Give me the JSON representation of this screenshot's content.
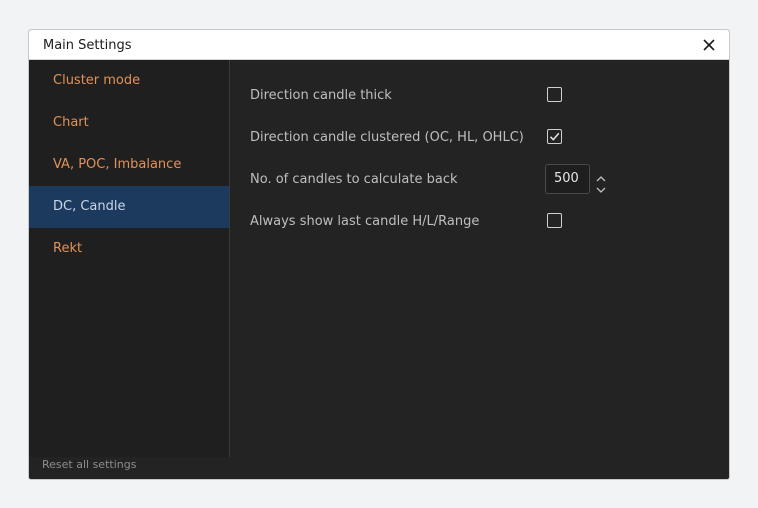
{
  "dialog": {
    "title": "Main Settings",
    "close_icon": "close-icon"
  },
  "sidebar": {
    "items": [
      {
        "label": "Cluster mode",
        "active": false
      },
      {
        "label": "Chart",
        "active": false
      },
      {
        "label": "VA, POC, Imbalance",
        "active": false
      },
      {
        "label": "DC, Candle",
        "active": true
      },
      {
        "label": "Rekt",
        "active": false
      }
    ],
    "reset_label": "Reset all settings"
  },
  "settings": {
    "direction_candle_thick": {
      "label": "Direction candle thick",
      "checked": false
    },
    "direction_candle_clustered": {
      "label": "Direction candle clustered (OC, HL, OHLC)",
      "checked": true
    },
    "candles_back": {
      "label": "No. of candles to calculate back",
      "value": "500"
    },
    "always_show_last": {
      "label": "Always show last candle H/L/Range",
      "checked": false
    }
  },
  "colors": {
    "accent_orange": "#e0925a",
    "active_nav_bg": "#1b3a5e",
    "panel_bg": "#232323"
  }
}
